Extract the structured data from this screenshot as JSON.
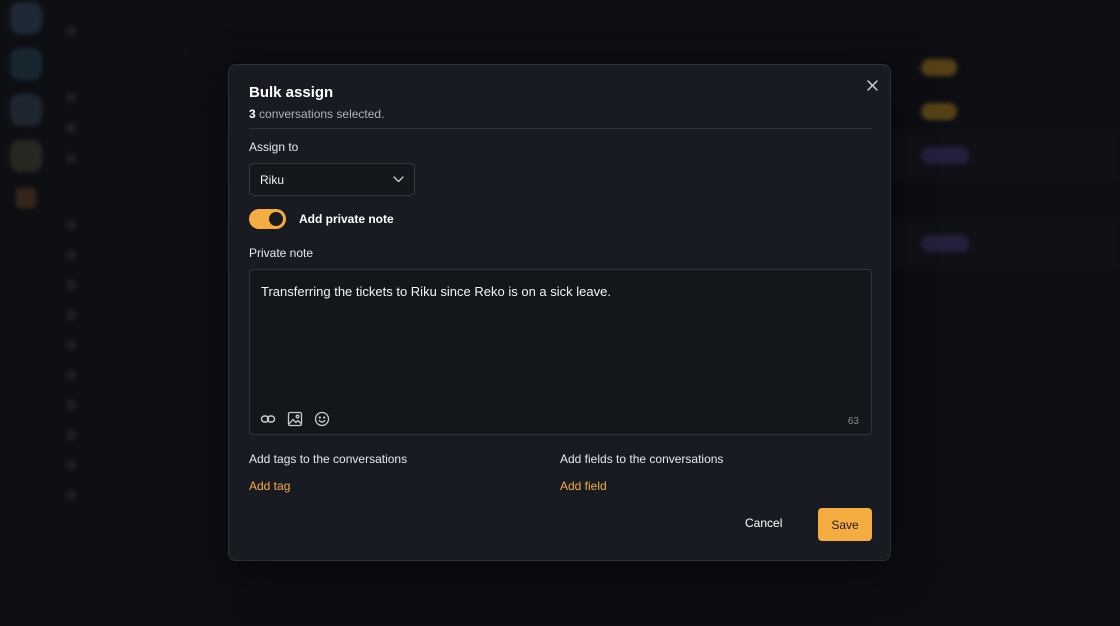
{
  "modal": {
    "title": "Bulk assign",
    "selected_count": "3",
    "selected_suffix": " conversations selected.",
    "assign_label": "Assign to",
    "assign_value": "Riku",
    "toggle_label": "Add private note",
    "toggle_on": true,
    "note_label": "Private note",
    "note_text": "Transferring the tickets to Riku since Reko is on a sick leave.",
    "char_count": "63",
    "tags_label": "Add tags to the conversations",
    "add_tag": "Add tag",
    "fields_label": "Add fields to the conversations",
    "add_field": "Add field",
    "cancel": "Cancel",
    "save": "Save"
  },
  "colors": {
    "accent": "#f5ad42",
    "modal_bg": "#181b21",
    "page_bg": "#121419"
  },
  "icons": [
    "close-icon",
    "chevron-down-icon",
    "link-icon",
    "image-icon",
    "emoji-icon"
  ]
}
